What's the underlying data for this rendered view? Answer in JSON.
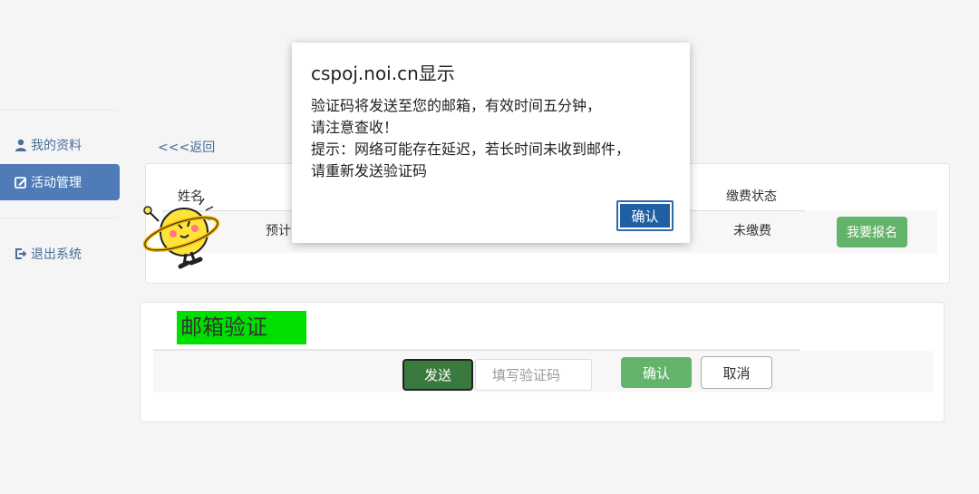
{
  "sidebar": {
    "items": [
      {
        "label": "我的资料",
        "icon": "user-icon"
      },
      {
        "label": "活动管理",
        "icon": "edit-icon",
        "active": true
      },
      {
        "label": "退出系统",
        "icon": "logout-icon"
      }
    ]
  },
  "back_link": "<<<返回",
  "registration_table": {
    "headers": {
      "name": "姓名",
      "fee_status": "缴费状态"
    },
    "row": {
      "prefix": "预计",
      "fee_status": "未缴费",
      "action": "我要报名"
    }
  },
  "email_verify": {
    "title": "邮箱验证",
    "send_label": "发送",
    "code_placeholder": "填写验证码",
    "confirm_label": "确认",
    "cancel_label": "取消"
  },
  "dialog": {
    "title": "cspoj.noi.cn显示",
    "lines": [
      "验证码将发送至您的邮箱，有效时间五分钟，",
      "请注意查收！",
      "提示：网络可能存在延迟，若长时间未收到邮件，",
      "请重新发送验证码"
    ],
    "ok_label": "确认"
  },
  "colors": {
    "accent": "#4f7bb8",
    "success": "#63b46a",
    "send_active": "#3b7a3e",
    "highlight": "#00e000",
    "dialog_button": "#1f5fa3"
  }
}
